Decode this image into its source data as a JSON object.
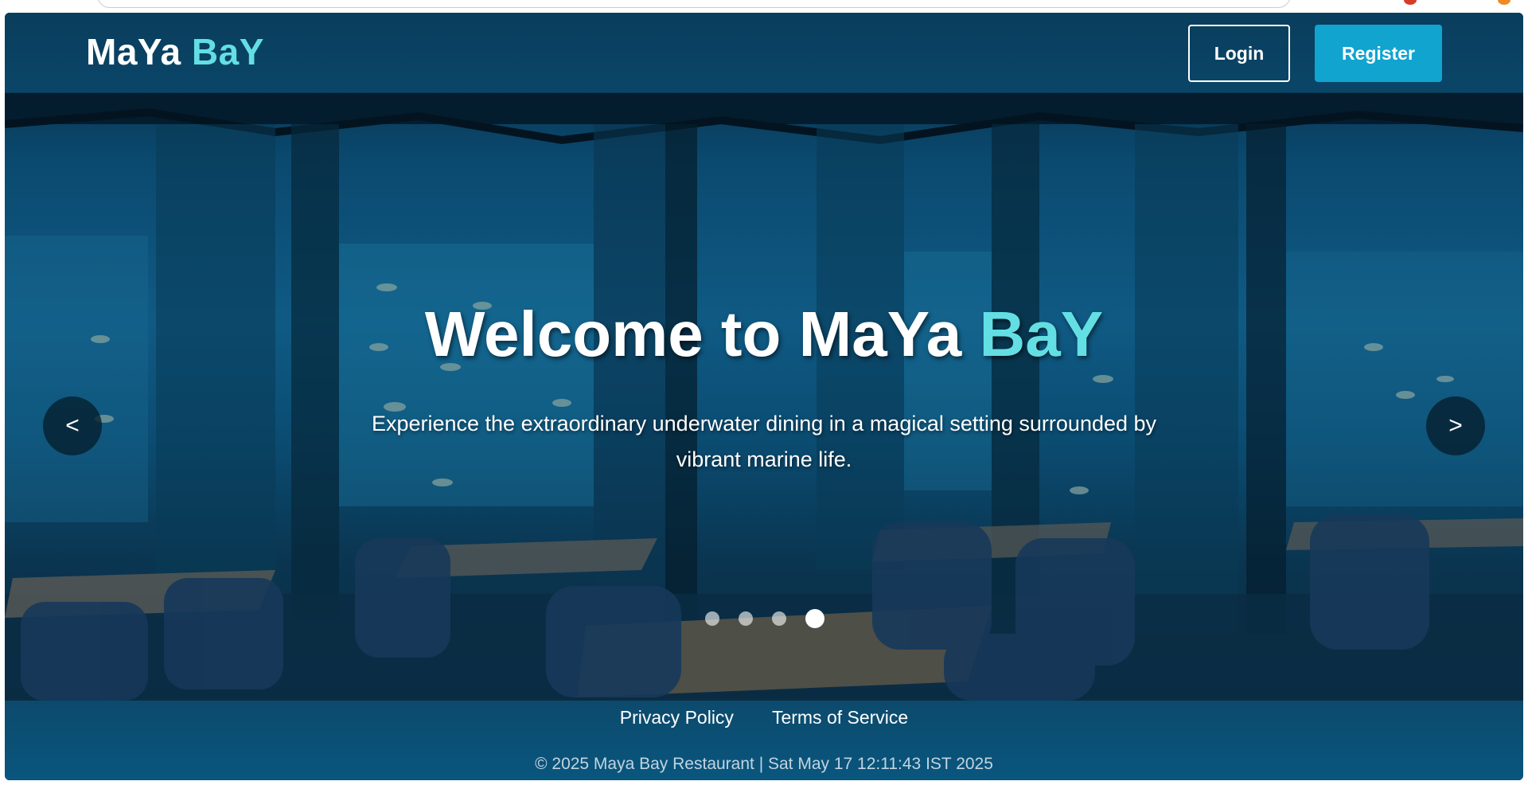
{
  "brand": {
    "name_main": "MaYa",
    "name_accent": "BaY"
  },
  "nav": {
    "login_label": "Login",
    "register_label": "Register"
  },
  "hero": {
    "title_main": "Welcome to MaYa",
    "title_accent": "BaY",
    "subtitle_line1": "Experience the extraordinary underwater dining in a magical setting surrounded by",
    "subtitle_line2": "vibrant marine life."
  },
  "carousel": {
    "prev_label": "<",
    "next_label": ">",
    "slide_count": 4,
    "active_slide": 4
  },
  "footer": {
    "links": [
      "Privacy Policy",
      "Terms of Service"
    ],
    "copyright": "© 2025 Maya Bay Restaurant | Sat May 17 12:11:43 IST 2025"
  },
  "colors": {
    "accent": "#63dfe3",
    "register_bg": "#10a4cf",
    "overlay": "#0b4566"
  }
}
